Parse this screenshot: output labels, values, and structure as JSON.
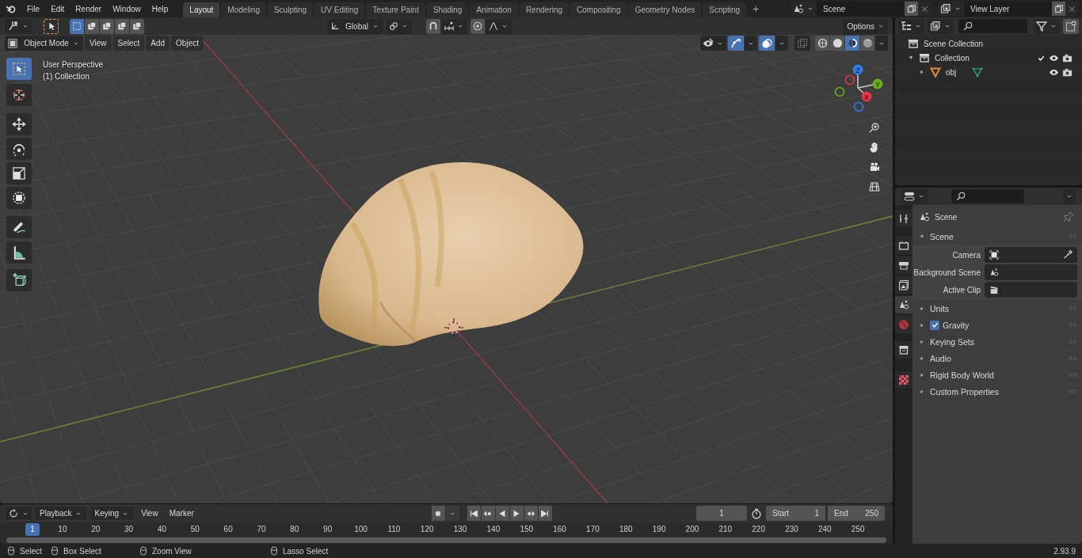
{
  "top_bar": {
    "menus": [
      "File",
      "Edit",
      "Render",
      "Window",
      "Help"
    ],
    "workspaces": [
      {
        "label": "Layout",
        "selected": true
      },
      {
        "label": "Modeling",
        "selected": false
      },
      {
        "label": "Sculpting",
        "selected": false
      },
      {
        "label": "UV Editing",
        "selected": false
      },
      {
        "label": "Texture Paint",
        "selected": false
      },
      {
        "label": "Shading",
        "selected": false
      },
      {
        "label": "Animation",
        "selected": false
      },
      {
        "label": "Rendering",
        "selected": false
      },
      {
        "label": "Compositing",
        "selected": false
      },
      {
        "label": "Geometry Nodes",
        "selected": false
      },
      {
        "label": "Scripting",
        "selected": false
      }
    ],
    "add_tab": "+",
    "scene": "Scene",
    "view_layer": "View Layer"
  },
  "viewport": {
    "select_modes": [
      {
        "selected": true
      },
      {
        "selected": false
      },
      {
        "selected": false
      },
      {
        "selected": false
      },
      {
        "selected": false
      }
    ],
    "orientation": "Global",
    "options": "Options",
    "mode": "Object Mode",
    "menus": [
      "View",
      "Select",
      "Add",
      "Object"
    ],
    "show_gizmos": true,
    "show_overlays": true,
    "shading_modes": [
      {
        "selected": false
      },
      {
        "selected": false
      },
      {
        "selected": true
      },
      {
        "selected": false
      }
    ],
    "overlay_text": [
      "User Perspective",
      "(1) Collection"
    ],
    "tools": [
      {
        "selected": true
      },
      {
        "selected": false
      },
      {
        "selected": false
      },
      {
        "selected": false
      },
      {
        "selected": false
      },
      {
        "selected": false
      },
      {
        "selected": false
      },
      {
        "selected": false
      },
      {
        "selected": false
      }
    ],
    "gizmo_axes": [
      "Z",
      "Y",
      "X"
    ]
  },
  "outliner": {
    "items": [
      {
        "label": "Scene Collection",
        "kind": "scene_collection",
        "children": [
          {
            "label": "Collection",
            "kind": "collection",
            "expanded": true,
            "checked": true,
            "children": [
              {
                "label": "obj",
                "kind": "mesh_object",
                "expanded": false
              }
            ]
          }
        ]
      }
    ]
  },
  "properties": {
    "tabs": [
      {
        "selected": false
      },
      {
        "selected": false
      },
      {
        "selected": false
      },
      {
        "selected": false
      },
      {
        "selected": true
      },
      {
        "selected": false
      },
      {
        "selected": false
      },
      {
        "selected": false
      }
    ],
    "context": "Scene",
    "panels": [
      {
        "title": "Scene",
        "expanded": true,
        "fields": [
          {
            "label": "Camera",
            "kind": "camera"
          },
          {
            "label": "Background Scene",
            "kind": "scene"
          },
          {
            "label": "Active Clip",
            "kind": "clip"
          }
        ]
      },
      {
        "title": "Units",
        "expanded": false
      },
      {
        "title": "Gravity",
        "expanded": false,
        "checked": true
      },
      {
        "title": "Keying Sets",
        "expanded": false
      },
      {
        "title": "Audio",
        "expanded": false
      },
      {
        "title": "Rigid Body World",
        "expanded": false
      },
      {
        "title": "Custom Properties",
        "expanded": false
      }
    ]
  },
  "timeline": {
    "menus": [
      {
        "label": "Playback",
        "dropdown": true
      },
      {
        "label": "Keying",
        "dropdown": true
      },
      {
        "label": "View",
        "dropdown": false
      },
      {
        "label": "Marker",
        "dropdown": false
      }
    ],
    "current_frame": "1",
    "start_label": "Start",
    "start": "1",
    "end_label": "End",
    "end": "250",
    "frame_indicator": "1",
    "ruler_labels": [
      "10",
      "20",
      "30",
      "40",
      "50",
      "60",
      "70",
      "80",
      "90",
      "100",
      "110",
      "120",
      "130",
      "140",
      "150",
      "160",
      "170",
      "180",
      "190",
      "200",
      "210",
      "220",
      "230",
      "240",
      "250"
    ]
  },
  "status_bar": {
    "hints": [
      "Select",
      "Box Select",
      "Zoom View",
      "Lasso Select"
    ],
    "version": "2.93.9"
  }
}
